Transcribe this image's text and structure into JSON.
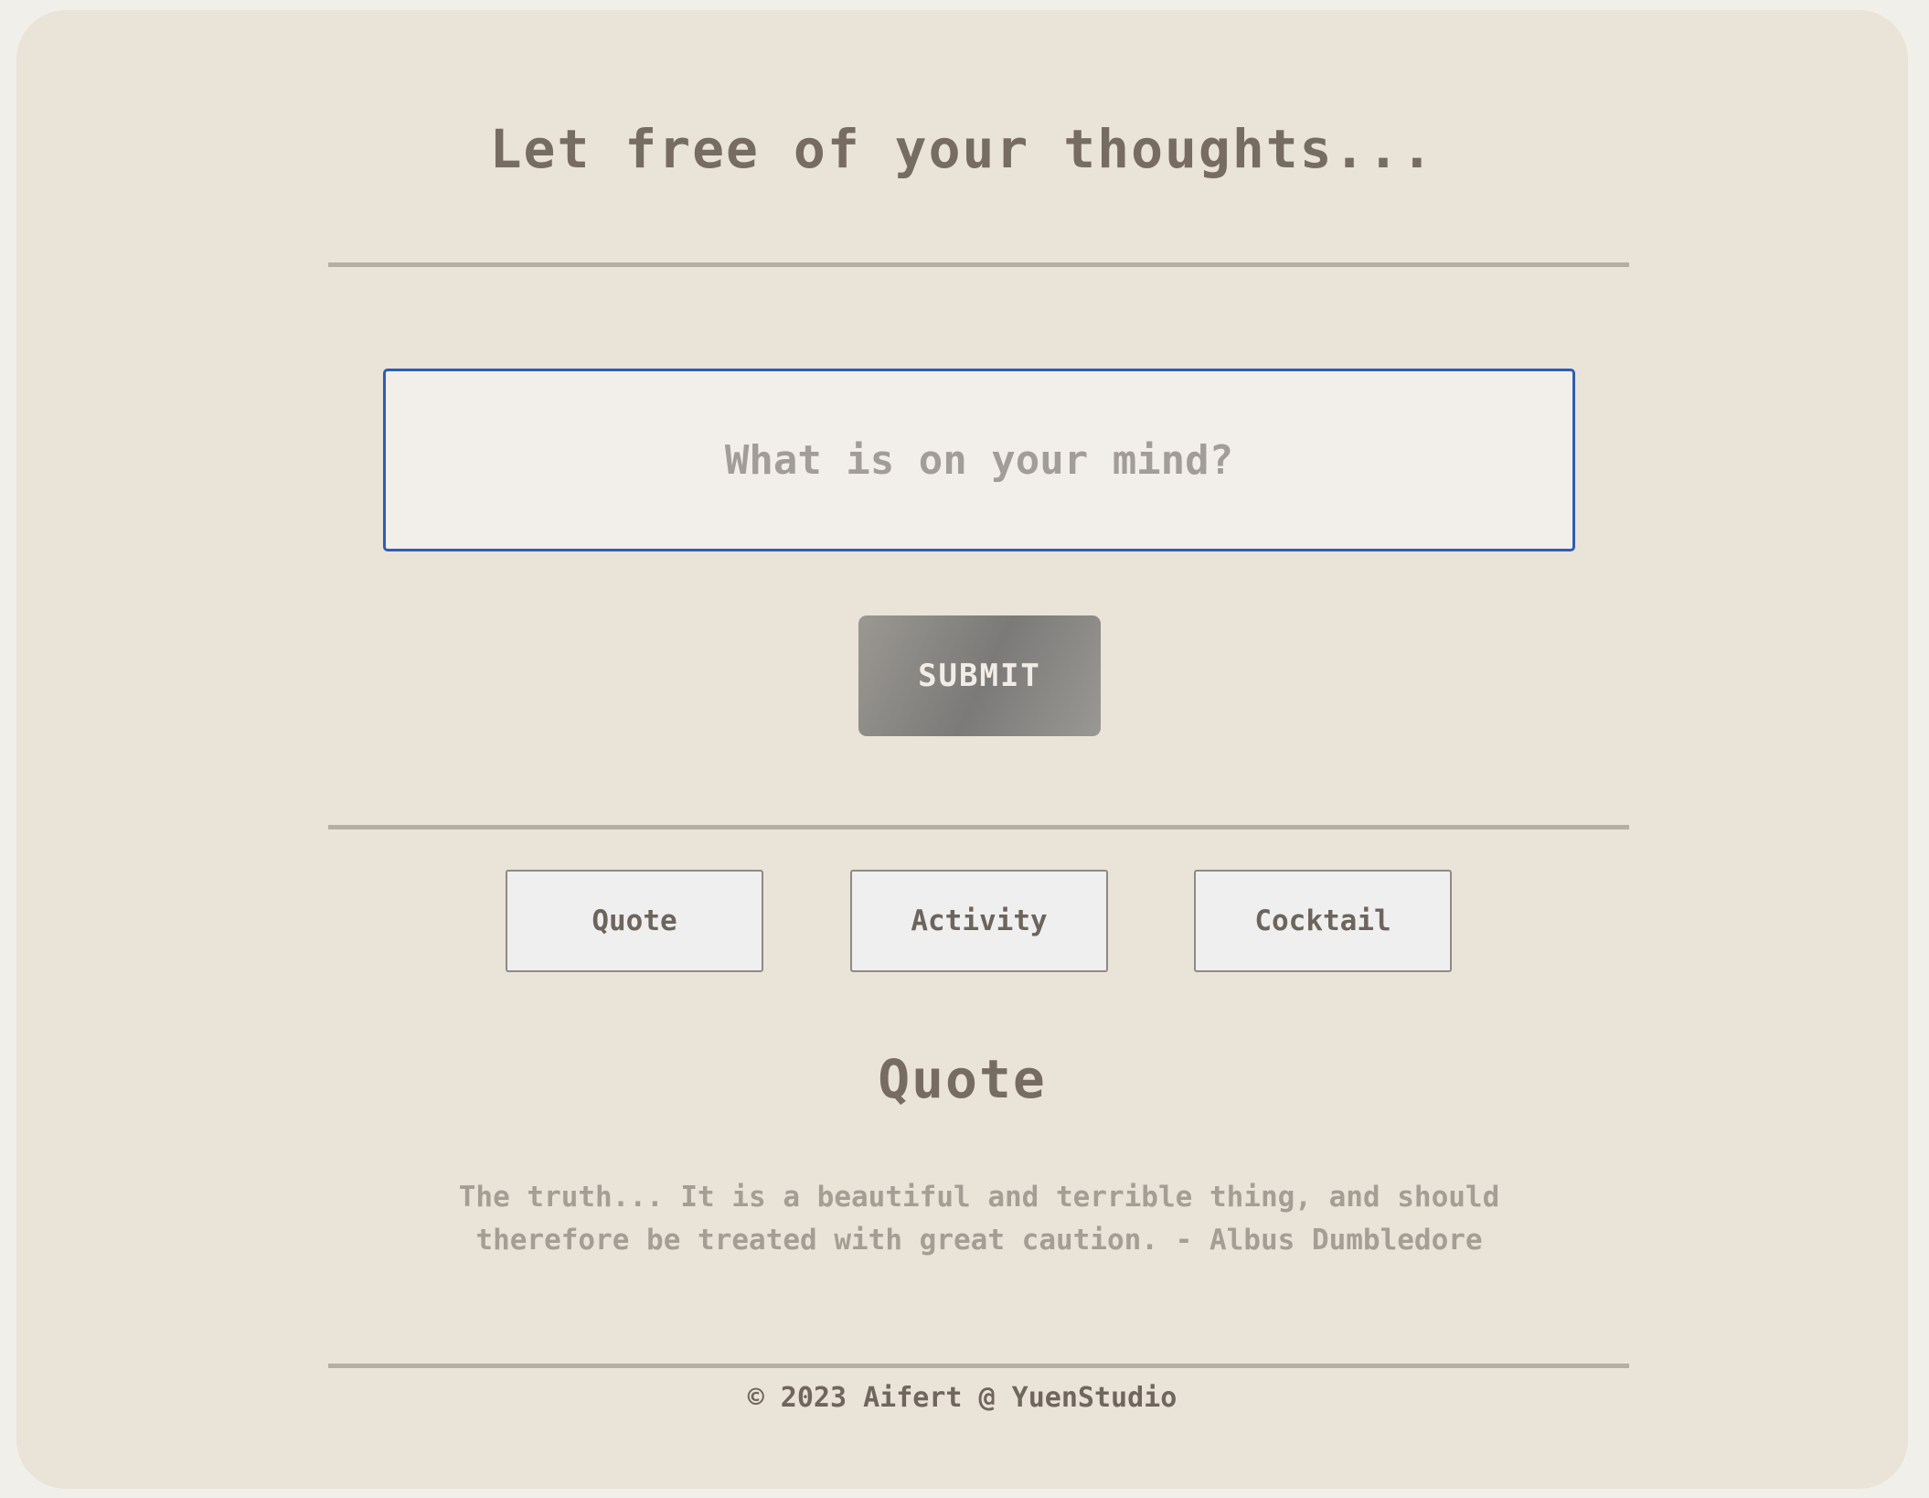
{
  "header": {
    "title": "Let free of your thoughts..."
  },
  "thought_input": {
    "value": "",
    "placeholder": "What is on your mind?"
  },
  "submit_button": {
    "label": "SUBMIT"
  },
  "categories": [
    {
      "label": "Quote"
    },
    {
      "label": "Activity"
    },
    {
      "label": "Cocktail"
    }
  ],
  "result": {
    "heading": "Quote",
    "text": "The truth... It is a beautiful and terrible thing, and should therefore be treated with great caution. - Albus Dumbledore"
  },
  "footer": {
    "text": "© 2023 Aifert @ YuenStudio"
  },
  "colors": {
    "background": "#eae3d7",
    "page_outer": "#f1efea",
    "text_primary": "#776c62",
    "input_border_focus": "#2f5db2"
  }
}
